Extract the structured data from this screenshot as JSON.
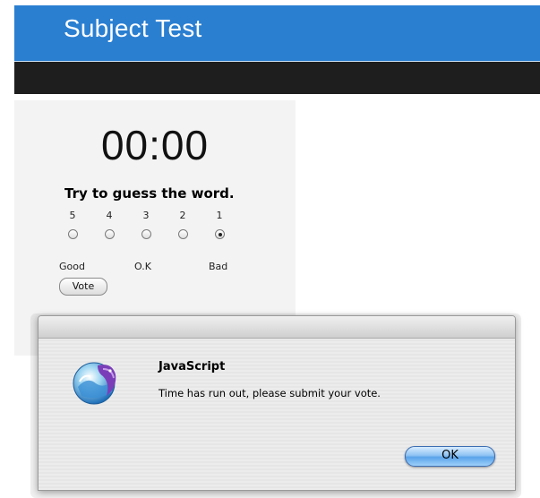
{
  "header": {
    "title": "Subject Test"
  },
  "timer": {
    "value": "00:00"
  },
  "question": {
    "prompt": "Try to guess the word."
  },
  "rating": {
    "options": [
      {
        "label": "5",
        "selected": false
      },
      {
        "label": "4",
        "selected": false
      },
      {
        "label": "3",
        "selected": false
      },
      {
        "label": "2",
        "selected": false
      },
      {
        "label": "1",
        "selected": true
      }
    ],
    "scale_labels": {
      "good": "Good",
      "ok": "O.K",
      "bad": "Bad"
    },
    "vote_label": "Vote"
  },
  "dialog": {
    "title": "JavaScript",
    "message": "Time has run out, please submit your vote.",
    "ok_label": "OK",
    "icon": "safari-icon"
  },
  "colors": {
    "header_bg": "#2a7fd1",
    "navbar_bg": "#1e1e1e",
    "panel_bg": "#f3f3f3",
    "ok_button": "#5aa3ea"
  }
}
